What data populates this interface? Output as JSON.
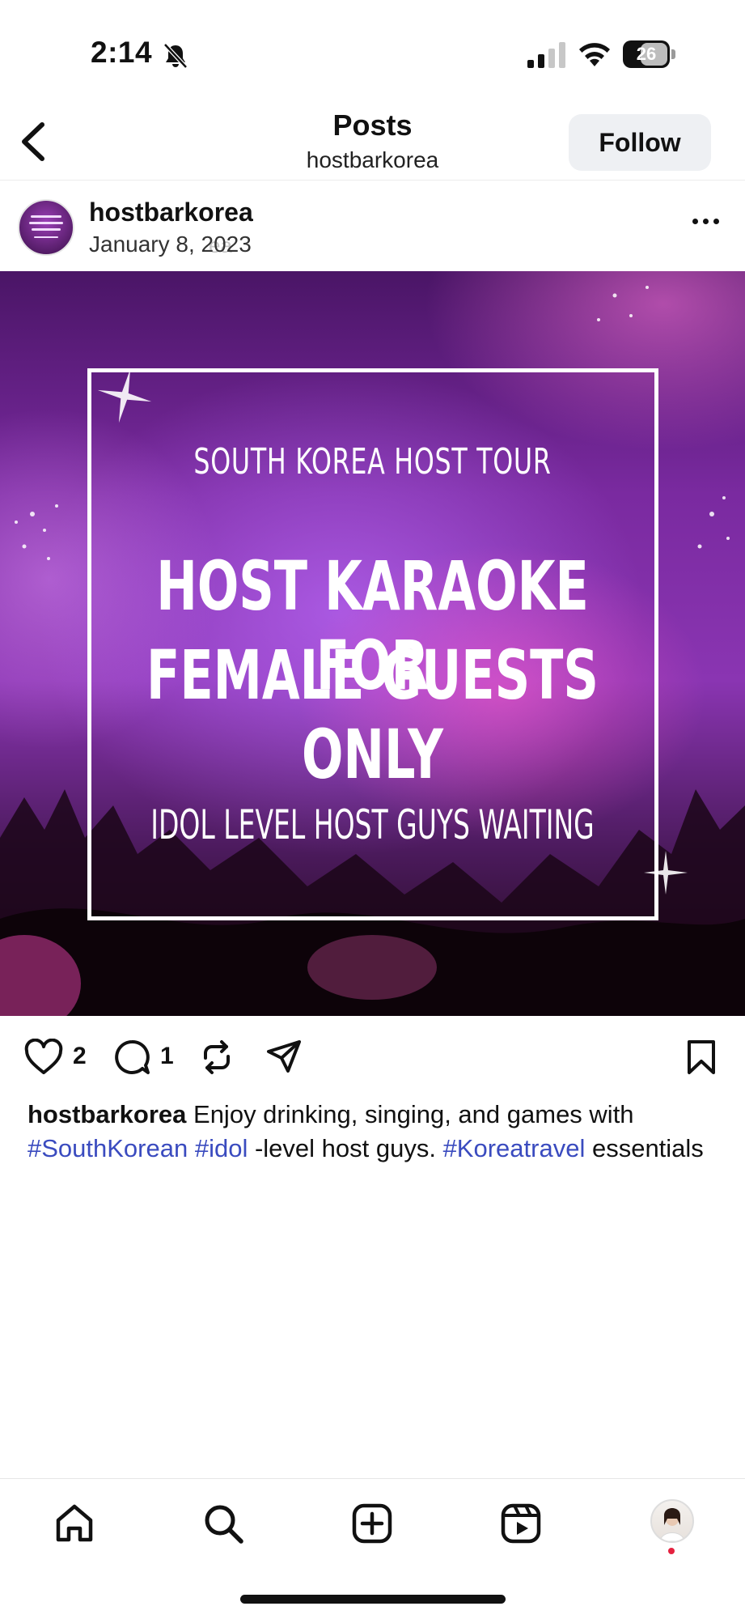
{
  "status_bar": {
    "time": "2:14",
    "battery": "26"
  },
  "header": {
    "title": "Posts",
    "subtitle": "hostbarkorea",
    "follow_label": "Follow"
  },
  "post": {
    "username": "hostbarkorea",
    "date": "January 8, 2023",
    "ghost_text": "ea",
    "image_text": {
      "line1": "SOUTH KOREA HOST TOUR",
      "line2": "HOST KARAOKE FOR",
      "line3": "FEMALE GUESTS ONLY",
      "line4": "IDOL LEVEL HOST GUYS WAITING"
    },
    "likes": "2",
    "comments": "1",
    "caption": {
      "username": "hostbarkorea",
      "text1": " Enjoy drinking, singing, and games with ",
      "tag1": "#SouthKorean",
      "space": " ",
      "tag2": "#idol",
      "text2": " -level host guys. ",
      "tag3": "#Koreatravel",
      "text3": " essentials"
    }
  },
  "icons": {
    "status": [
      "bell-slash-icon",
      "signal-icon",
      "wifi-icon",
      "battery-icon"
    ],
    "post_actions": [
      "heart-icon",
      "comment-icon",
      "repost-icon",
      "share-icon",
      "bookmark-icon"
    ],
    "nav": [
      "home-icon",
      "search-icon",
      "create-icon",
      "reels-icon",
      "profile-avatar"
    ]
  },
  "colors": {
    "hashtag": "#3a4bbf",
    "follow_bg": "#eef0f3",
    "notification_dot": "#e5213f"
  }
}
